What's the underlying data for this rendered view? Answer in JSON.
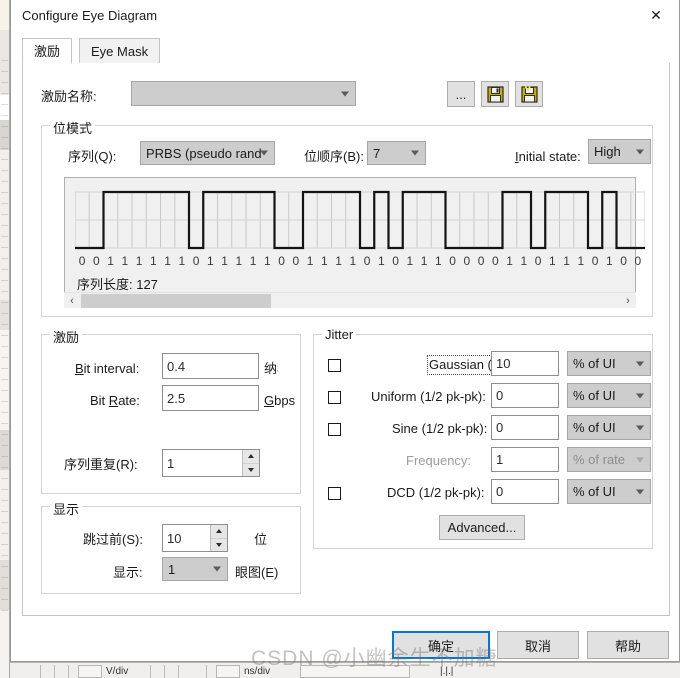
{
  "window": {
    "title": "Configure Eye Diagram",
    "close_label": "✕"
  },
  "tabs": [
    {
      "label": "激励",
      "active": true
    },
    {
      "label": "Eye Mask",
      "active": false
    }
  ],
  "stimulus_name": {
    "label": "激励名称:",
    "value": "",
    "browse_label": "...",
    "save_icon": "floppy-disk-icon",
    "save_as_icon": "floppy-disk-star-icon"
  },
  "bit_pattern": {
    "title": "位模式",
    "sequence_label": "序列(Q):",
    "sequence_value": "PRBS (pseudo rand",
    "order_label": "位顺序(B):",
    "order_value": "7",
    "initial_state_label": "Initial state:",
    "initial_state_value": "High",
    "seq_length_label": "序列长度: 127",
    "bits": [
      "0",
      "0",
      "1",
      "1",
      "1",
      "1",
      "1",
      "1",
      "0",
      "1",
      "1",
      "1",
      "1",
      "1",
      "0",
      "0",
      "1",
      "1",
      "1",
      "1",
      "0",
      "1",
      "0",
      "1",
      "1",
      "1",
      "0",
      "0",
      "0",
      "0",
      "1",
      "1",
      "0",
      "1",
      "1",
      "1",
      "0",
      "1",
      "0",
      "0"
    ],
    "scroll_left": "‹",
    "scroll_right": "›"
  },
  "stimulus": {
    "title": "激励",
    "bit_interval_label": "Bit interval:",
    "bit_interval_label_accel": "B",
    "bit_interval_value": "0.4",
    "bit_interval_unit": "纳秒",
    "bit_rate_label": "Bit Rate:",
    "bit_rate_label_accel": "R",
    "bit_rate_value": "2.5",
    "bit_rate_unit": "Gbps",
    "repeat_label": "序列重复(R):",
    "repeat_value": "1"
  },
  "display": {
    "title": "显示",
    "skip_label": "跳过前(S):",
    "skip_value": "10",
    "skip_unit": "位",
    "show_label": "显示:",
    "show_value": "1",
    "show_unit": "眼图(E)"
  },
  "jitter": {
    "title": "Jitter",
    "rows": [
      {
        "checkbox": true,
        "enabled": true,
        "label": "Gaussian (s):",
        "value": "10",
        "unit": "% of UI",
        "focused": true
      },
      {
        "checkbox": true,
        "enabled": true,
        "label": "Uniform (1/2 pk-pk):",
        "value": "0",
        "unit": "% of UI",
        "focused": false
      },
      {
        "checkbox": true,
        "enabled": true,
        "label": "Sine (1/2 pk-pk):",
        "value": "0",
        "unit": "% of UI",
        "focused": false
      },
      {
        "checkbox": false,
        "enabled": false,
        "label": "Frequency:",
        "value": "1",
        "unit": "% of rate",
        "focused": false
      },
      {
        "checkbox": true,
        "enabled": true,
        "label": "DCD (1/2 pk-pk):",
        "value": "0",
        "unit": "% of UI",
        "focused": false
      }
    ],
    "advanced_label": "Advanced..."
  },
  "footer": {
    "ok_label": "确定",
    "cancel_label": "取消",
    "help_label": "帮助"
  },
  "watermark": "CSDN @小幽余生不加糖",
  "background_app": {
    "volts_per_div": "V/div",
    "time_per_div": "ns/div"
  },
  "colors": {
    "accent": "#0078d7",
    "dialog_bg": "#ffffff",
    "group_border": "#d4d4d4",
    "combo_bg": "#cdcdcd",
    "text": "#1b1b1b",
    "disabled_text": "#9b9b9b"
  }
}
